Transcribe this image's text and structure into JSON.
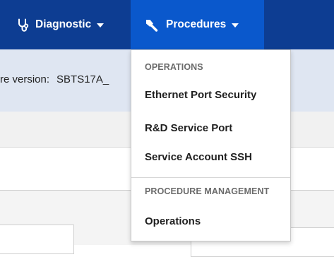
{
  "nav": {
    "diagnostic_label": "Diagnostic",
    "procedures_label": "Procedures"
  },
  "subheader": {
    "version_label": "re version:",
    "version_value": "SBTS17A_"
  },
  "procedures_menu": {
    "sections": [
      {
        "header": "OPERATIONS",
        "items": [
          "Ethernet Port Security",
          "R&D Service Port",
          "Service Account SSH"
        ]
      },
      {
        "header": "PROCEDURE MANAGEMENT",
        "items": [
          "Operations"
        ]
      }
    ]
  },
  "colors": {
    "nav_bar": "#0d3d92",
    "nav_active": "#0a58cc",
    "subheader": "#dfe6f2"
  },
  "icons": {
    "diagnostic": "stethoscope-icon",
    "procedures": "wrench-icon"
  }
}
